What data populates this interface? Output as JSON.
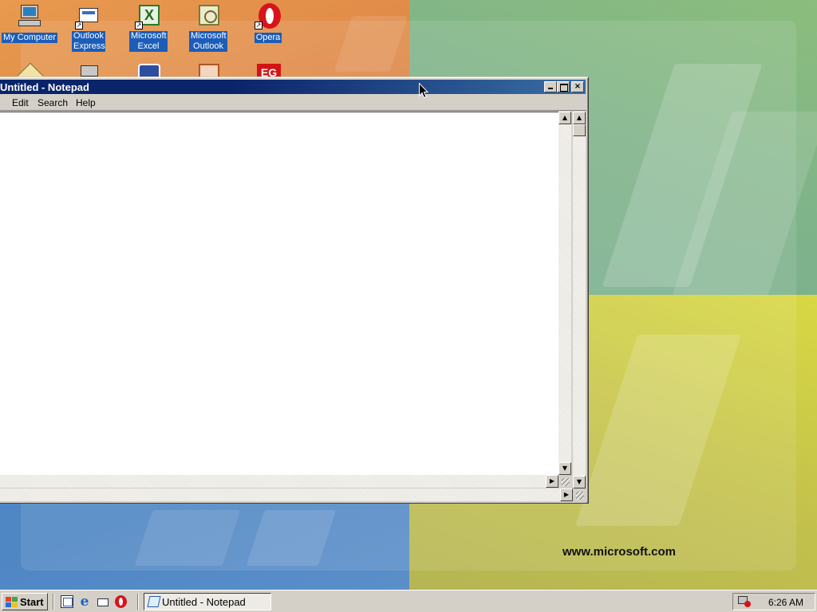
{
  "desktop": {
    "icons": [
      {
        "label": "My Computer"
      },
      {
        "label": "Outlook Express"
      },
      {
        "label": "Microsoft Excel"
      },
      {
        "label": "Microsoft Outlook"
      },
      {
        "label": "Opera"
      }
    ],
    "partial_icons": [
      "folder-icon",
      "network-icon",
      "ie-settings-icon",
      "powerpoint-icon",
      "eg-app-icon"
    ],
    "wallpaper_text": "www.microsoft.com",
    "colors": {
      "orange": "#e0894a",
      "green": "#82b586",
      "blue": "#4f86c4",
      "yellow": "#c9c84a"
    }
  },
  "window": {
    "title": "Untitled - Notepad",
    "menu": [
      "Edit",
      "Search",
      "Help"
    ],
    "text_value": "",
    "buttons": {
      "minimize": "_",
      "maximize": "□",
      "close": "×"
    },
    "title_color": "#0a246a"
  },
  "taskbar": {
    "start_label": "Start",
    "quick_launch": [
      "show-desktop-icon",
      "internet-explorer-icon",
      "outlook-express-icon",
      "opera-icon"
    ],
    "task_label": "Untitled - Notepad",
    "clock": "6:26 AM"
  }
}
